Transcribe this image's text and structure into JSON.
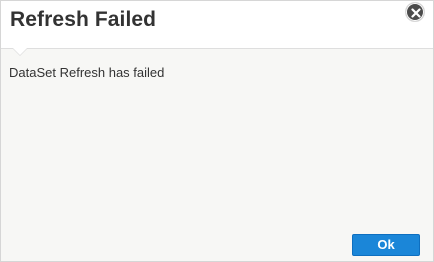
{
  "dialog": {
    "title": "Refresh Failed",
    "message": "DataSet Refresh has failed",
    "ok_label": "Ok",
    "close_icon": "close-icon",
    "colors": {
      "background": "#f7f7f5",
      "header": "#ffffff",
      "title_text": "#333333",
      "ok_button": "#1b86d8",
      "close_button": "#4b4b4b"
    }
  }
}
